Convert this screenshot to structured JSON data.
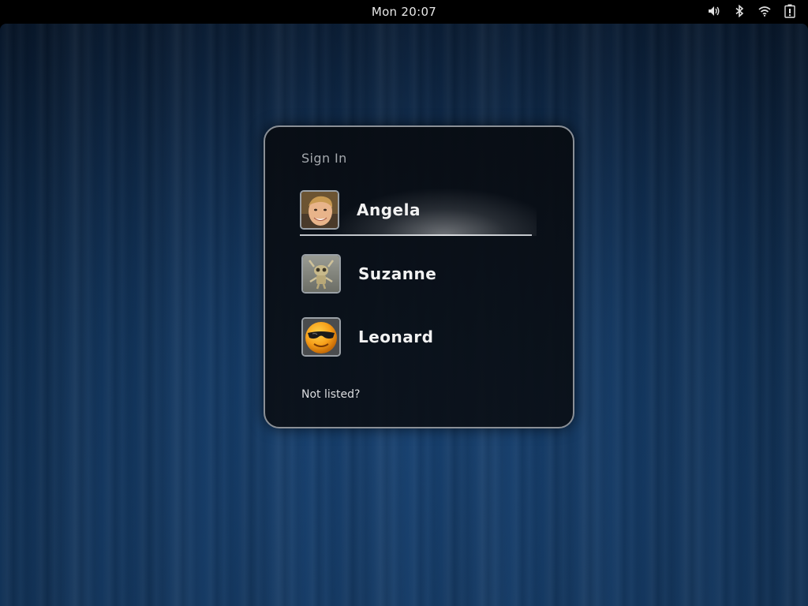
{
  "topbar": {
    "clock": "Mon 20:07",
    "icons": [
      "volume-icon",
      "bluetooth-icon",
      "wifi-icon",
      "battery-icon"
    ]
  },
  "dialog": {
    "title": "Sign In",
    "users": [
      {
        "name": "Angela",
        "avatar": "person-photo",
        "selected": true
      },
      {
        "name": "Suzanne",
        "avatar": "robot-figure"
      },
      {
        "name": "Leonard",
        "avatar": "sunglasses-smiley"
      }
    ],
    "not_listed": "Not listed?"
  },
  "colors": {
    "background": "#123a66",
    "dialog": "#0a0f16",
    "text": "#f2f2f2",
    "muted_text": "#a4a8ad",
    "border": "#8a8f96"
  }
}
